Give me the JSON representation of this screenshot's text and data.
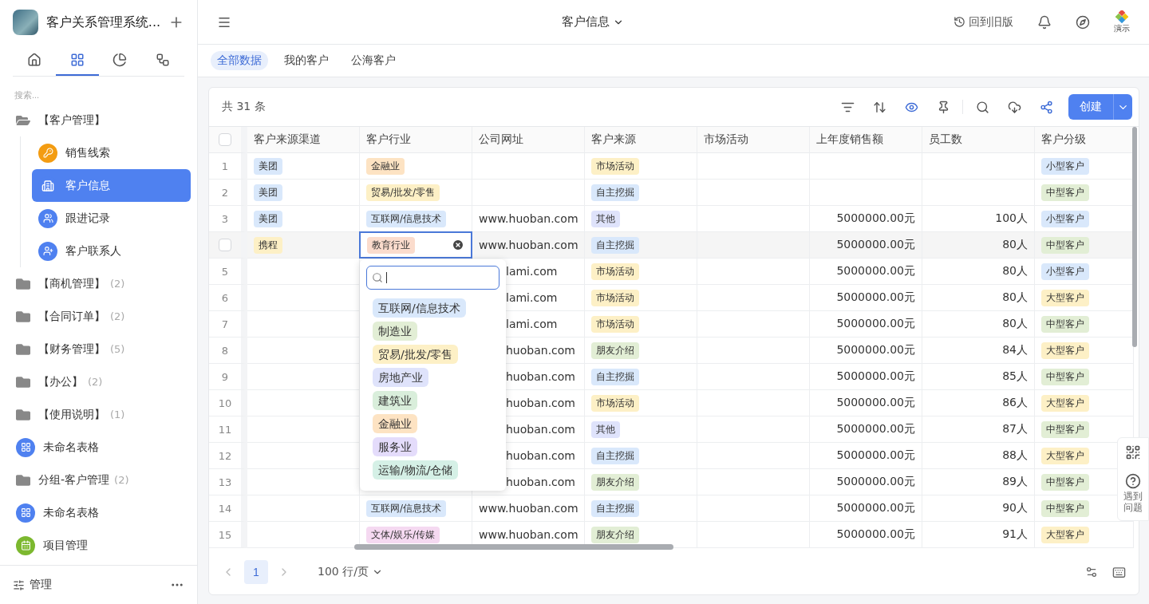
{
  "sidebar": {
    "app_title": "客户关系管理系统...",
    "nav_tabs": [
      {
        "kind": "home",
        "selected": false
      },
      {
        "kind": "tables",
        "selected": true
      },
      {
        "kind": "charts",
        "selected": false
      },
      {
        "kind": "flows",
        "selected": false
      }
    ],
    "search": {
      "placeholder": "搜索..."
    },
    "items": [
      {
        "kind": "folder",
        "label": "【客户管理】",
        "expanded": true,
        "children": [
          {
            "kind": "key",
            "label": "销售线索",
            "selected": false
          },
          {
            "kind": "building",
            "label": "客户信息",
            "selected": true
          },
          {
            "kind": "people",
            "label": "跟进记录",
            "selected": false
          },
          {
            "kind": "contact",
            "label": "客户联系人",
            "selected": false
          }
        ]
      },
      {
        "kind": "folder",
        "label": "【商机管理】",
        "count": "(2)",
        "expanded": false
      },
      {
        "kind": "folder",
        "label": "【合同订单】",
        "count": "(2)",
        "expanded": false
      },
      {
        "kind": "folder",
        "label": "【财务管理】",
        "count": "(5)",
        "expanded": false
      },
      {
        "kind": "folder",
        "label": "【办公】",
        "count": "(2)",
        "expanded": false
      },
      {
        "kind": "folder",
        "label": "【使用说明】",
        "count": "(1)",
        "expanded": false
      },
      {
        "kind": "table",
        "label": "未命名表格",
        "selected": false
      },
      {
        "kind": "plainfolder",
        "label": "分组-客户管理",
        "count": "(2)"
      },
      {
        "kind": "table",
        "label": "未命名表格",
        "selected": false
      },
      {
        "kind": "app",
        "label": "项目管理",
        "selected": false
      }
    ],
    "footer": {
      "label": "管理"
    }
  },
  "header": {
    "title": "客户信息",
    "back_label": "回到旧版",
    "logo_label": "演示"
  },
  "view_tabs": [
    {
      "label": "全部数据",
      "selected": true
    },
    {
      "label": "我的客户",
      "selected": false
    },
    {
      "label": "公海客户",
      "selected": false
    }
  ],
  "toolbar": {
    "total": "共 31 条",
    "hide_fields_active": true,
    "create_label": "创建"
  },
  "table": {
    "all_checked": false,
    "columns": [
      {
        "label": "客户来源渠道",
        "kind": "tag"
      },
      {
        "label": "客户行业",
        "kind": "tag"
      },
      {
        "label": "公司网址",
        "kind": "text"
      },
      {
        "label": "客户来源",
        "kind": "tag"
      },
      {
        "label": "市场活动",
        "kind": "text"
      },
      {
        "label": "上年度销售额",
        "kind": "number"
      },
      {
        "label": "员工数",
        "kind": "number"
      },
      {
        "label": "客户分级",
        "kind": "tag"
      }
    ],
    "rows": [
      {
        "number": "1",
        "hovered": false,
        "checked": false,
        "cells": [
          {
            "text": "美团",
            "color": "#d9e8fb"
          },
          {
            "text": "金融业",
            "color": "#fde3c3"
          },
          null,
          {
            "text": "市场活动",
            "color": "#fdf0c6"
          },
          null,
          null,
          null,
          {
            "text": "小型客户",
            "color": "#d9e8fb"
          }
        ]
      },
      {
        "number": "2",
        "hovered": false,
        "checked": false,
        "cells": [
          {
            "text": "美团",
            "color": "#d9e8fb"
          },
          {
            "text": "贸易/批发/零售",
            "color": "#fdf0c6"
          },
          null,
          {
            "text": "自主挖掘",
            "color": "#d9e8fb"
          },
          null,
          null,
          null,
          {
            "text": "中型客户",
            "color": "#e2eed5"
          }
        ]
      },
      {
        "number": "3",
        "hovered": false,
        "checked": false,
        "cells": [
          {
            "text": "美团",
            "color": "#d9e8fb"
          },
          {
            "text": "互联网/信息技术",
            "color": "#d9e8fb"
          },
          "www.huoban.com",
          {
            "text": "其他",
            "color": "#dfe3fb"
          },
          null,
          "5000000.00元",
          "100人",
          {
            "text": "小型客户",
            "color": "#d9e8fb"
          }
        ]
      },
      {
        "hovered": true,
        "checked": false,
        "cells": [
          {
            "text": "携程",
            "color": "#fdf0c6"
          },
          {
            "text": "教育行业",
            "color": "#fbdccd",
            "editing": true
          },
          "www.huoban.com",
          {
            "text": "自主挖掘",
            "color": "#d9e8fb"
          },
          null,
          "5000000.00元",
          "80人",
          {
            "text": "中型客户",
            "color": "#e2eed5"
          }
        ]
      },
      {
        "number": "5",
        "hovered": false,
        "checked": false,
        "cells": [
          null,
          null,
          "lami.com",
          {
            "text": "市场活动",
            "color": "#fdf0c6"
          },
          null,
          "5000000.00元",
          "80人",
          {
            "text": "小型客户",
            "color": "#d9e8fb"
          }
        ]
      },
      {
        "number": "6",
        "hovered": false,
        "checked": false,
        "cells": [
          null,
          null,
          "lami.com",
          {
            "text": "市场活动",
            "color": "#fdf0c6"
          },
          null,
          "5000000.00元",
          "80人",
          {
            "text": "大型客户",
            "color": "#fdf0c6"
          }
        ]
      },
      {
        "number": "7",
        "hovered": false,
        "checked": false,
        "cells": [
          null,
          null,
          "lami.com",
          {
            "text": "市场活动",
            "color": "#fdf0c6"
          },
          null,
          "5000000.00元",
          "80人",
          {
            "text": "中型客户",
            "color": "#e2eed5"
          }
        ]
      },
      {
        "number": "8",
        "hovered": false,
        "checked": false,
        "cells": [
          null,
          null,
          "huoban.com",
          {
            "text": "朋友介绍",
            "color": "#e2eed5"
          },
          null,
          "5000000.00元",
          "84人",
          {
            "text": "大型客户",
            "color": "#fdf0c6"
          }
        ]
      },
      {
        "number": "9",
        "hovered": false,
        "checked": false,
        "cells": [
          null,
          null,
          "huoban.com",
          {
            "text": "自主挖掘",
            "color": "#d9e8fb"
          },
          null,
          "5000000.00元",
          "85人",
          {
            "text": "中型客户",
            "color": "#e2eed5"
          }
        ]
      },
      {
        "number": "10",
        "hovered": false,
        "checked": false,
        "cells": [
          null,
          null,
          "huoban.com",
          {
            "text": "市场活动",
            "color": "#fdf0c6"
          },
          null,
          "5000000.00元",
          "86人",
          {
            "text": "大型客户",
            "color": "#fdf0c6"
          }
        ]
      },
      {
        "number": "11",
        "hovered": false,
        "checked": false,
        "cells": [
          null,
          null,
          "huoban.com",
          {
            "text": "其他",
            "color": "#dfe3fb"
          },
          null,
          "5000000.00元",
          "87人",
          {
            "text": "中型客户",
            "color": "#e2eed5"
          }
        ]
      },
      {
        "number": "12",
        "hovered": false,
        "checked": false,
        "cells": [
          null,
          null,
          "huoban.com",
          {
            "text": "自主挖掘",
            "color": "#d9e8fb"
          },
          null,
          "5000000.00元",
          "88人",
          {
            "text": "大型客户",
            "color": "#fdf0c6"
          }
        ]
      },
      {
        "number": "13",
        "hovered": false,
        "checked": false,
        "cells": [
          null,
          null,
          "huoban.com",
          {
            "text": "朋友介绍",
            "color": "#e2eed5"
          },
          null,
          "5000000.00元",
          "89人",
          {
            "text": "中型客户",
            "color": "#e2eed5"
          }
        ]
      },
      {
        "number": "14",
        "hovered": false,
        "checked": false,
        "cells": [
          null,
          {
            "text": "互联网/信息技术",
            "color": "#d9e8fb"
          },
          "www.huoban.com",
          {
            "text": "自主挖掘",
            "color": "#d9e8fb"
          },
          null,
          "5000000.00元",
          "90人",
          {
            "text": "中型客户",
            "color": "#e2eed5"
          }
        ]
      },
      {
        "number": "15",
        "hovered": false,
        "checked": false,
        "cells": [
          null,
          {
            "text": "文体/娱乐/传媒",
            "color": "#f5d9f1"
          },
          "www.huoban.com",
          {
            "text": "朋友介绍",
            "color": "#e2eed5"
          },
          null,
          "5000000.00元",
          "91人",
          {
            "text": "大型客户",
            "color": "#fdf0c6"
          }
        ]
      }
    ]
  },
  "dropdown": {
    "options": [
      {
        "text": "互联网/信息技术",
        "color": "#d9e8fb"
      },
      {
        "text": "制造业",
        "color": "#e2eed5"
      },
      {
        "text": "贸易/批发/零售",
        "color": "#fdf0c6"
      },
      {
        "text": "房地产业",
        "color": "#dfe3fb"
      },
      {
        "text": "建筑业",
        "color": "#d9eedb"
      },
      {
        "text": "金融业",
        "color": "#fde3c3"
      },
      {
        "text": "服务业",
        "color": "#e4dcfb"
      },
      {
        "text": "运输/物流/仓储",
        "color": "#d5f0e6"
      }
    ]
  },
  "pagination": {
    "pages": [
      {
        "label": "1",
        "selected": true
      }
    ],
    "page_size": "100 行/页"
  },
  "help": {
    "label": "遇到问题"
  }
}
